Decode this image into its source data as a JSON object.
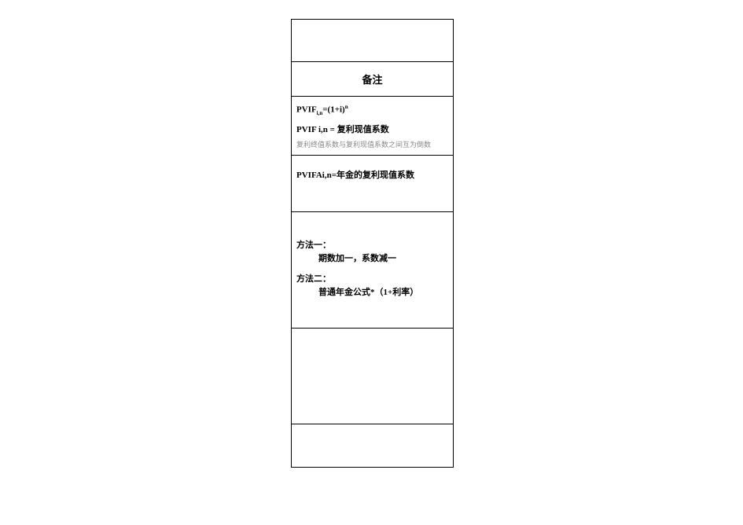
{
  "header": "备注",
  "pvif": {
    "formula_prefix": "PVIF",
    "formula_sub": "i,n",
    "formula_eq": "=(1+i)",
    "formula_sup": "n",
    "line2": "PVIF i,n = 复利现值系数",
    "line3": "复利终值系数与复利现值系数之间互为倒数"
  },
  "pvifa": {
    "line": "PVIFAi,n=年金的复利现值系数"
  },
  "methods": {
    "m1_title": "方法一：",
    "m1_body": "期数加一，系数减一",
    "m2_title": "方法二：",
    "m2_body": "普通年金公式*（1+利率）"
  }
}
